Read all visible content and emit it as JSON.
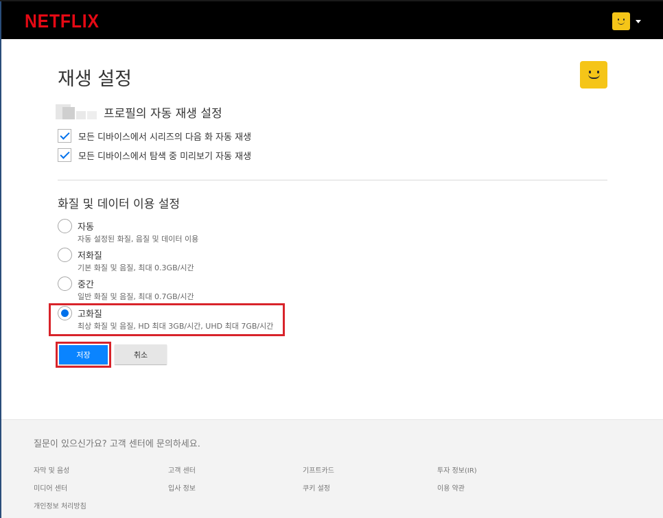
{
  "header": {
    "logo": "NETFLIX",
    "brand_color": "#e50914",
    "profile_icon": "smiley-avatar-icon",
    "menu_icon": "caret-down-icon"
  },
  "main": {
    "title": "재생 설정",
    "autoplay": {
      "heading": "프로필의 자동 재생 설정",
      "options": [
        {
          "label": "모든 디바이스에서 시리즈의 다음 화 자동 재생",
          "checked": true
        },
        {
          "label": "모든 디바이스에서 탐색 중 미리보기 자동 재생",
          "checked": true
        }
      ]
    },
    "quality": {
      "heading": "화질 및 데이터 이용 설정",
      "options": [
        {
          "title": "자동",
          "desc": "자동 설정된 화질, 음질 및 데이터 이용",
          "selected": false
        },
        {
          "title": "저화질",
          "desc": "기본 화질 및 음질, 최대 0.3GB/시간",
          "selected": false
        },
        {
          "title": "중간",
          "desc": "일반 화질 및 음질, 최대 0.7GB/시간",
          "selected": false
        },
        {
          "title": "고화질",
          "desc": "최상 화질 및 음질, HD 최대 3GB/시간, UHD 최대 7GB/시간",
          "selected": true
        }
      ]
    },
    "save_label": "저장",
    "cancel_label": "취소",
    "accent_color": "#0071eb"
  },
  "footer": {
    "question": "질문이 있으신가요? 고객 센터에 문의하세요.",
    "links": [
      "자막 및 음성",
      "고객 센터",
      "기프트카드",
      "투자 정보(IR)",
      "미디어 센터",
      "입사 정보",
      "쿠키 설정",
      "이용 약관",
      "개인정보 처리방침"
    ]
  }
}
